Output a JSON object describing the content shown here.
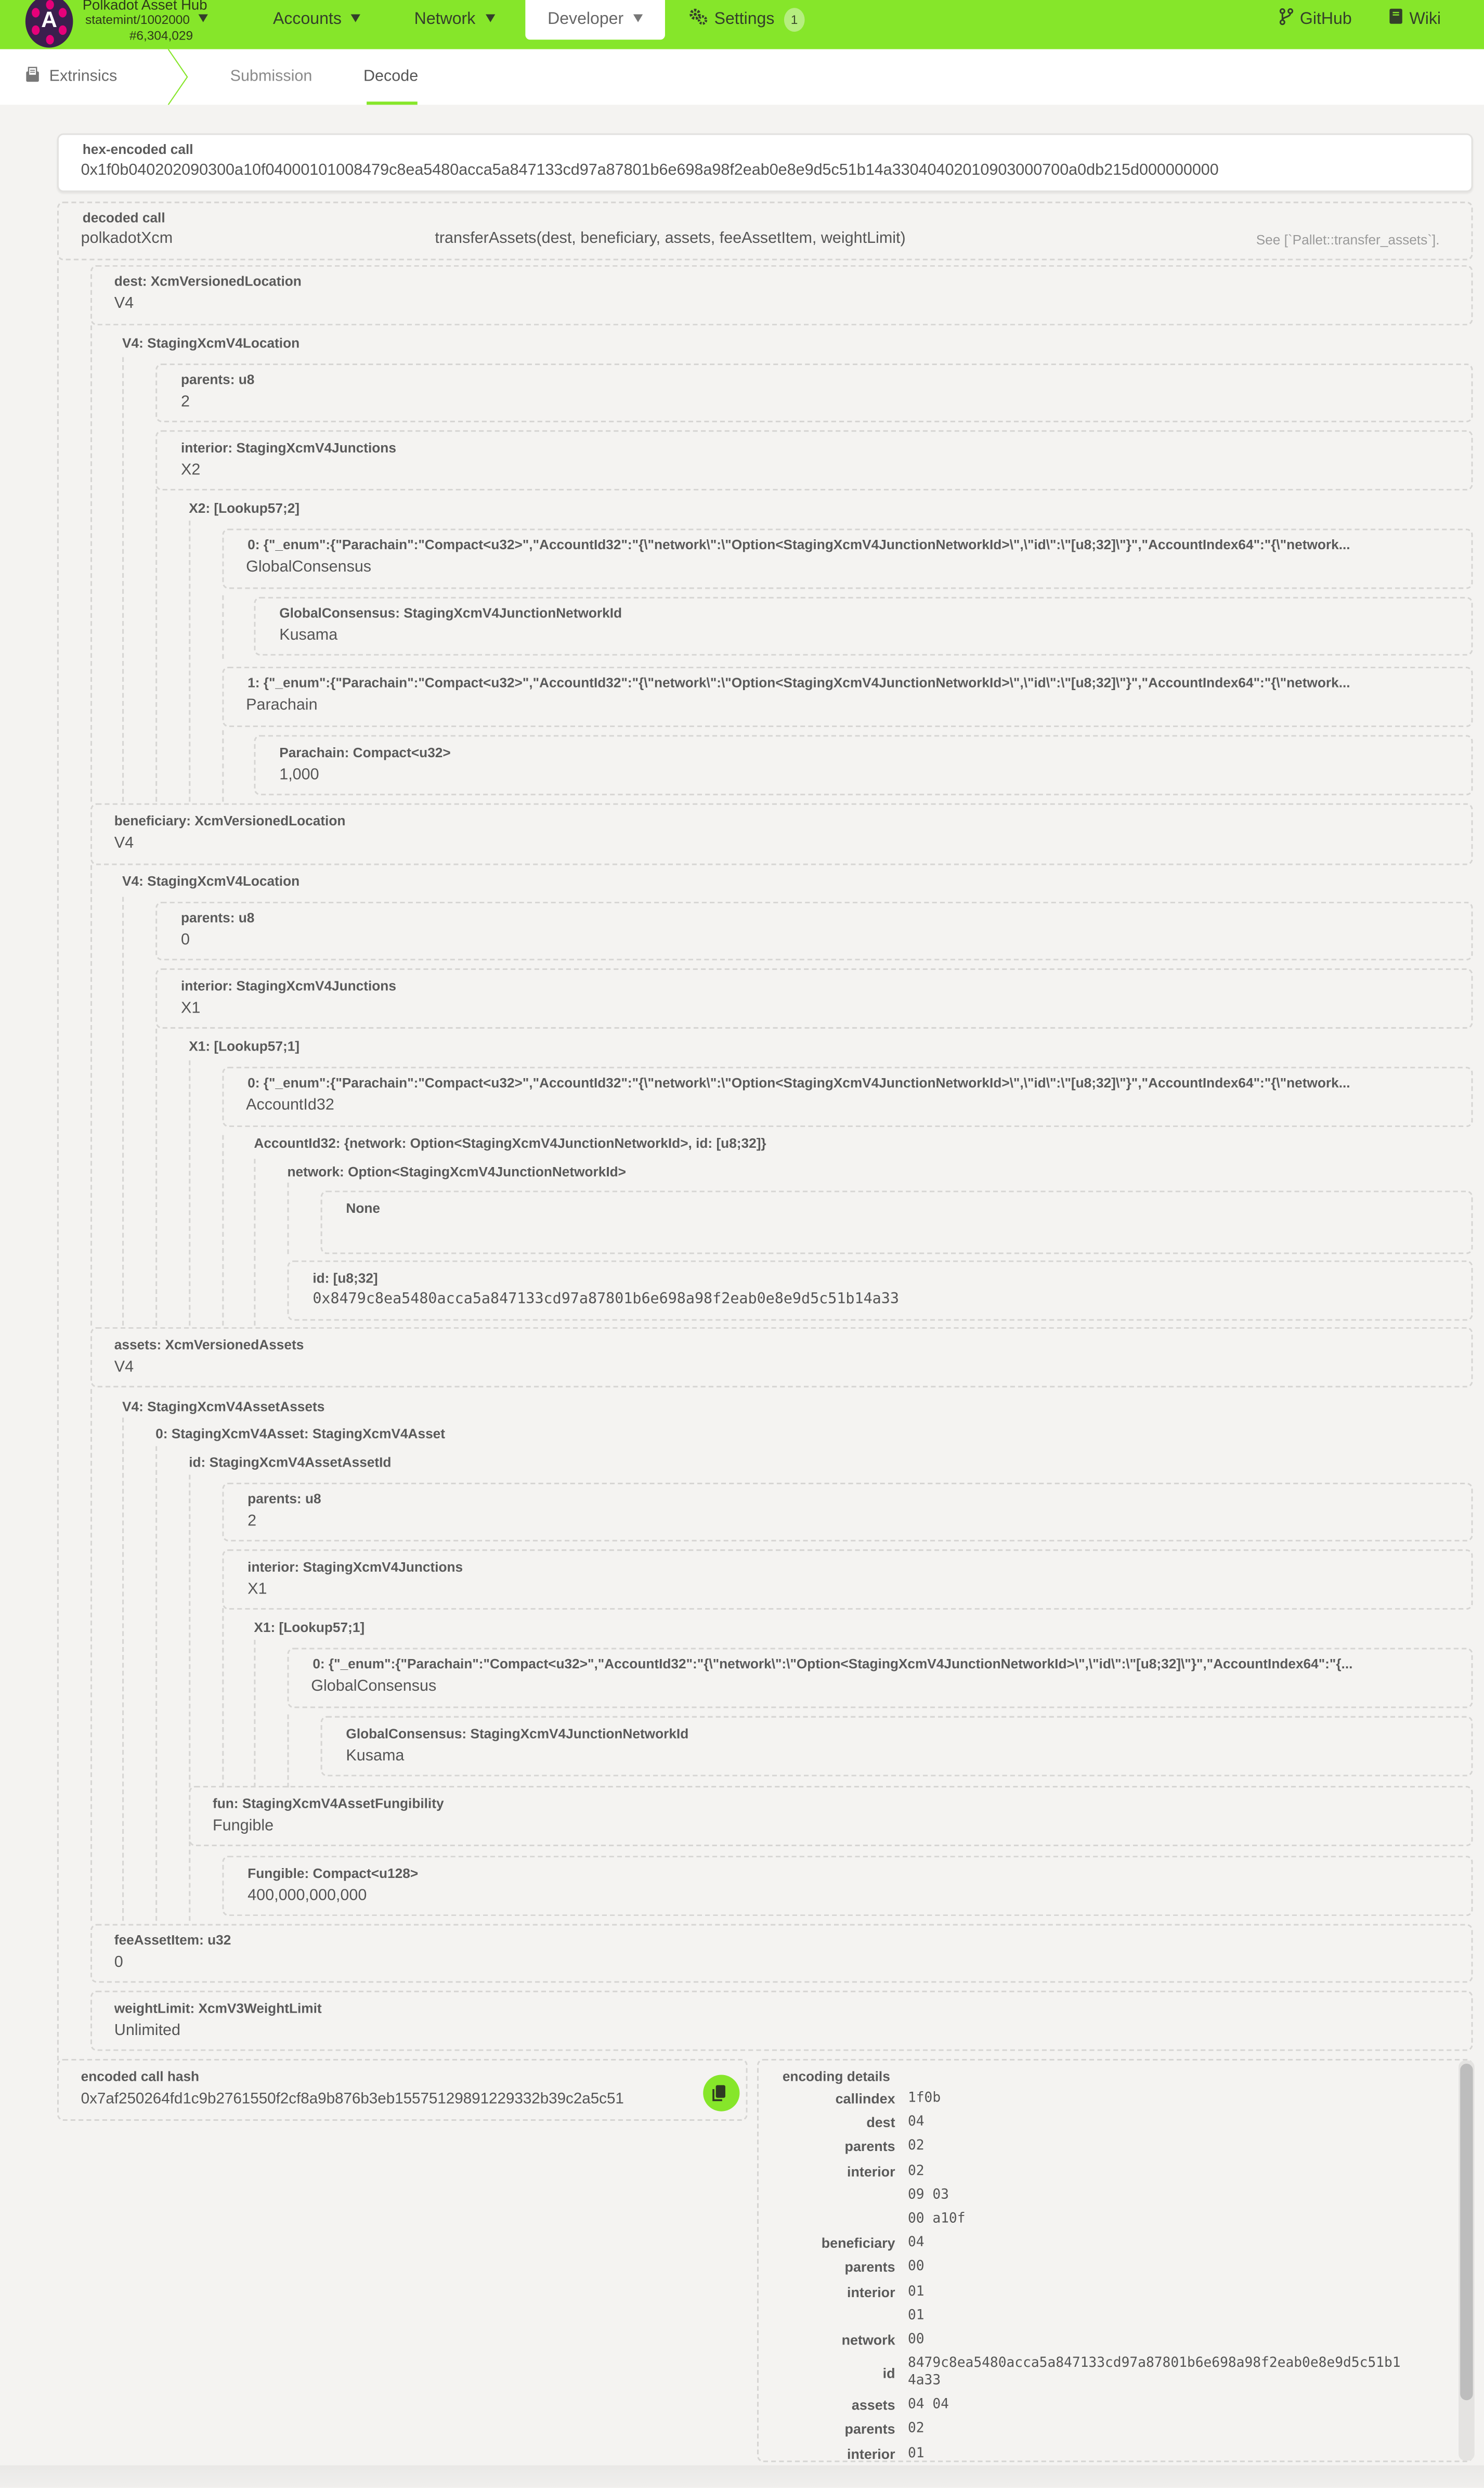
{
  "header": {
    "app_name": "Polkadot Asset Hub",
    "chain_spec": "statemint/1002000",
    "block_number": "#6,304,029",
    "logo_letter": "A",
    "nav": [
      {
        "label": "Accounts"
      },
      {
        "label": "Network"
      },
      {
        "label": "Developer"
      },
      {
        "label": "Settings",
        "badge": "1"
      }
    ],
    "links": [
      {
        "label": "GitHub"
      },
      {
        "label": "Wiki"
      }
    ],
    "accent_color": "#86e62a"
  },
  "subnav": {
    "section": "Extrinsics",
    "tabs": [
      {
        "label": "Submission",
        "active": false
      },
      {
        "label": "Decode",
        "active": true
      }
    ]
  },
  "hex_call": {
    "label": "hex-encoded call",
    "value": "0x1f0b040202090300a10f04000101008479c8ea5480acca5a847133cd97a87801b6e698a98f2eab0e8e9d5c51b14a33040402010903000700a0db215d000000000"
  },
  "decoded_call": {
    "label": "decoded call",
    "pallet": "polkadotXcm",
    "method": "transferAssets(dest, beneficiary, assets, feeAssetItem, weightLimit)",
    "doc_hint": "See [`Pallet::transfer_assets`]."
  },
  "tree": {
    "dest": {
      "label": "dest: XcmVersionedLocation",
      "value": "V4"
    },
    "dest_v4": "V4: StagingXcmV4Location",
    "dest_parents": {
      "label": "parents: u8",
      "value": "2"
    },
    "dest_interior": {
      "label": "interior: StagingXcmV4Junctions",
      "value": "X2"
    },
    "dest_x2": "X2: [Lookup57;2]",
    "dest_j0": {
      "label": "0: {\"_enum\":{\"Parachain\":\"Compact<u32>\",\"AccountId32\":\"{\\\"network\\\":\\\"Option<StagingXcmV4JunctionNetworkId>\\\",\\\"id\\\":\\\"[u8;32]\\\"}\",\"AccountIndex64\":\"{\\\"network...",
      "value": "GlobalConsensus"
    },
    "dest_j0_gc": {
      "label": "GlobalConsensus: StagingXcmV4JunctionNetworkId",
      "value": "Kusama"
    },
    "dest_j1": {
      "label": "1: {\"_enum\":{\"Parachain\":\"Compact<u32>\",\"AccountId32\":\"{\\\"network\\\":\\\"Option<StagingXcmV4JunctionNetworkId>\\\",\\\"id\\\":\\\"[u8;32]\\\"}\",\"AccountIndex64\":\"{\\\"network...",
      "value": "Parachain"
    },
    "dest_j1_para": {
      "label": "Parachain: Compact<u32>",
      "value": "1,000"
    },
    "beneficiary": {
      "label": "beneficiary: XcmVersionedLocation",
      "value": "V4"
    },
    "ben_v4": "V4: StagingXcmV4Location",
    "ben_parents": {
      "label": "parents: u8",
      "value": "0"
    },
    "ben_interior": {
      "label": "interior: StagingXcmV4Junctions",
      "value": "X1"
    },
    "ben_x1": "X1: [Lookup57;1]",
    "ben_j0": {
      "label": "0: {\"_enum\":{\"Parachain\":\"Compact<u32>\",\"AccountId32\":\"{\\\"network\\\":\\\"Option<StagingXcmV4JunctionNetworkId>\\\",\\\"id\\\":\\\"[u8;32]\\\"}\",\"AccountIndex64\":\"{\\\"network...",
      "value": "AccountId32"
    },
    "ben_acc": "AccountId32: {network: Option<StagingXcmV4JunctionNetworkId>, id: [u8;32]}",
    "ben_network": "network: Option<StagingXcmV4JunctionNetworkId>",
    "ben_network_val": "None",
    "ben_id": {
      "label": "id: [u8;32]",
      "value": "0x8479c8ea5480acca5a847133cd97a87801b6e698a98f2eab0e8e9d5c51b14a33"
    },
    "assets": {
      "label": "assets: XcmVersionedAssets",
      "value": "V4"
    },
    "assets_v4": "V4: StagingXcmV4AssetAssets",
    "asset0": "0: StagingXcmV4Asset: StagingXcmV4Asset",
    "asset0_id": "id: StagingXcmV4AssetAssetId",
    "asset_parents": {
      "label": "parents: u8",
      "value": "2"
    },
    "asset_interior": {
      "label": "interior: StagingXcmV4Junctions",
      "value": "X1"
    },
    "asset_x1": "X1: [Lookup57;1]",
    "asset_j0": {
      "label": "0: {\"_enum\":{\"Parachain\":\"Compact<u32>\",\"AccountId32\":\"{\\\"network\\\":\\\"Option<StagingXcmV4JunctionNetworkId>\\\",\\\"id\\\":\\\"[u8;32]\\\"}\",\"AccountIndex64\":\"{...",
      "value": "GlobalConsensus"
    },
    "asset_j0_gc": {
      "label": "GlobalConsensus: StagingXcmV4JunctionNetworkId",
      "value": "Kusama"
    },
    "asset_fun": {
      "label": "fun: StagingXcmV4AssetFungibility",
      "value": "Fungible"
    },
    "asset_fungible": {
      "label": "Fungible: Compact<u128>",
      "value": "400,000,000,000"
    },
    "fee_asset_item": {
      "label": "feeAssetItem: u32",
      "value": "0"
    },
    "weight_limit": {
      "label": "weightLimit: XcmV3WeightLimit",
      "value": "Unlimited"
    }
  },
  "call_hash": {
    "label": "encoded call hash",
    "value": "0x7af250264fd1c9b2761550f2cf8a9b876b3eb15575129891229332b39c2a5c51"
  },
  "encoding": {
    "label": "encoding details",
    "rows": [
      {
        "key": "callindex",
        "value": "1f0b"
      },
      {
        "key": "dest",
        "value": "04"
      },
      {
        "key": "parents",
        "value": "02"
      },
      {
        "key": "interior",
        "value": "02"
      },
      {
        "key": "",
        "value": "09 03"
      },
      {
        "key": "",
        "value": "00 a10f"
      },
      {
        "key": "beneficiary",
        "value": "04"
      },
      {
        "key": "parents",
        "value": "00"
      },
      {
        "key": "interior",
        "value": "01"
      },
      {
        "key": "",
        "value": "01"
      },
      {
        "key": "network",
        "value": "00"
      },
      {
        "key": "id",
        "value": "8479c8ea5480acca5a847133cd97a87801b6e698a98f2eab0e8e9d5c51b1",
        "value2": "4a33"
      },
      {
        "key": "assets",
        "value": "04 04"
      },
      {
        "key": "parents",
        "value": "02"
      },
      {
        "key": "interior",
        "value": "01"
      }
    ]
  }
}
